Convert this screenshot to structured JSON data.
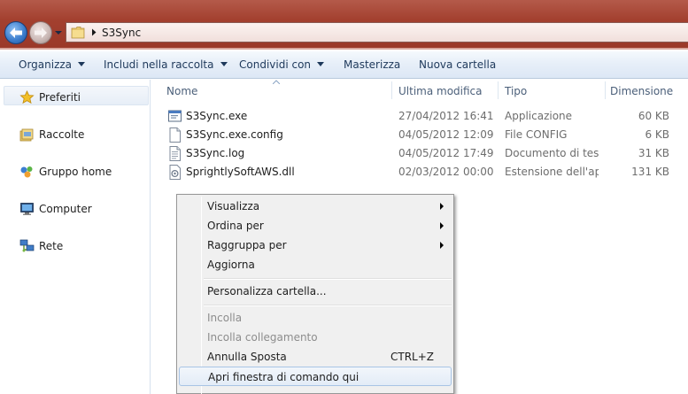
{
  "window": {
    "breadcrumb": "S3Sync"
  },
  "navigation": {
    "back_icon": "arrow-left-icon",
    "forward_icon": "arrow-right-icon"
  },
  "toolbar": {
    "organize": "Organizza",
    "include_in_library": "Includi nella raccolta",
    "share_with": "Condividi con",
    "burn": "Masterizza",
    "new_folder": "Nuova cartella"
  },
  "sidebar": {
    "items": [
      {
        "label": "Preferiti",
        "icon": "star-icon"
      },
      {
        "label": "Raccolte",
        "icon": "libraries-icon"
      },
      {
        "label": "Gruppo home",
        "icon": "homegroup-icon"
      },
      {
        "label": "Computer",
        "icon": "computer-icon"
      },
      {
        "label": "Rete",
        "icon": "network-icon"
      }
    ]
  },
  "columns": {
    "name": "Nome",
    "modified": "Ultima modifica",
    "type": "Tipo",
    "size": "Dimensione"
  },
  "files": [
    {
      "name": "S3Sync.exe",
      "modified": "27/04/2012 16:41",
      "type": "Applicazione",
      "size": "60 KB",
      "icon": "application-icon"
    },
    {
      "name": "S3Sync.exe.config",
      "modified": "04/05/2012 12:09",
      "type": "File CONFIG",
      "size": "6 KB",
      "icon": "document-icon"
    },
    {
      "name": "S3Sync.log",
      "modified": "04/05/2012 17:49",
      "type": "Documento di testo",
      "size": "31 KB",
      "icon": "text-document-icon"
    },
    {
      "name": "SprightlySoftAWS.dll",
      "modified": "02/03/2012 00:00",
      "type": "Estensione dell'ap...",
      "size": "131 KB",
      "icon": "dll-icon"
    }
  ],
  "context_menu": {
    "items": [
      {
        "label": "Visualizza",
        "submenu": true
      },
      {
        "label": "Ordina per",
        "submenu": true
      },
      {
        "label": "Raggruppa per",
        "submenu": true
      },
      {
        "label": "Aggiorna"
      },
      {
        "label": "Personalizza cartella..."
      },
      {
        "label": "Incolla",
        "disabled": true
      },
      {
        "label": "Incolla collegamento",
        "disabled": true
      },
      {
        "label": "Annulla Sposta",
        "shortcut": "CTRL+Z"
      },
      {
        "label": "Apri finestra di comando qui",
        "highlighted": true
      }
    ]
  },
  "colors": {
    "title_bar": "#a3402f",
    "toolbar_text": "#1e395b",
    "menu_highlight_border": "#a8c4e5"
  }
}
